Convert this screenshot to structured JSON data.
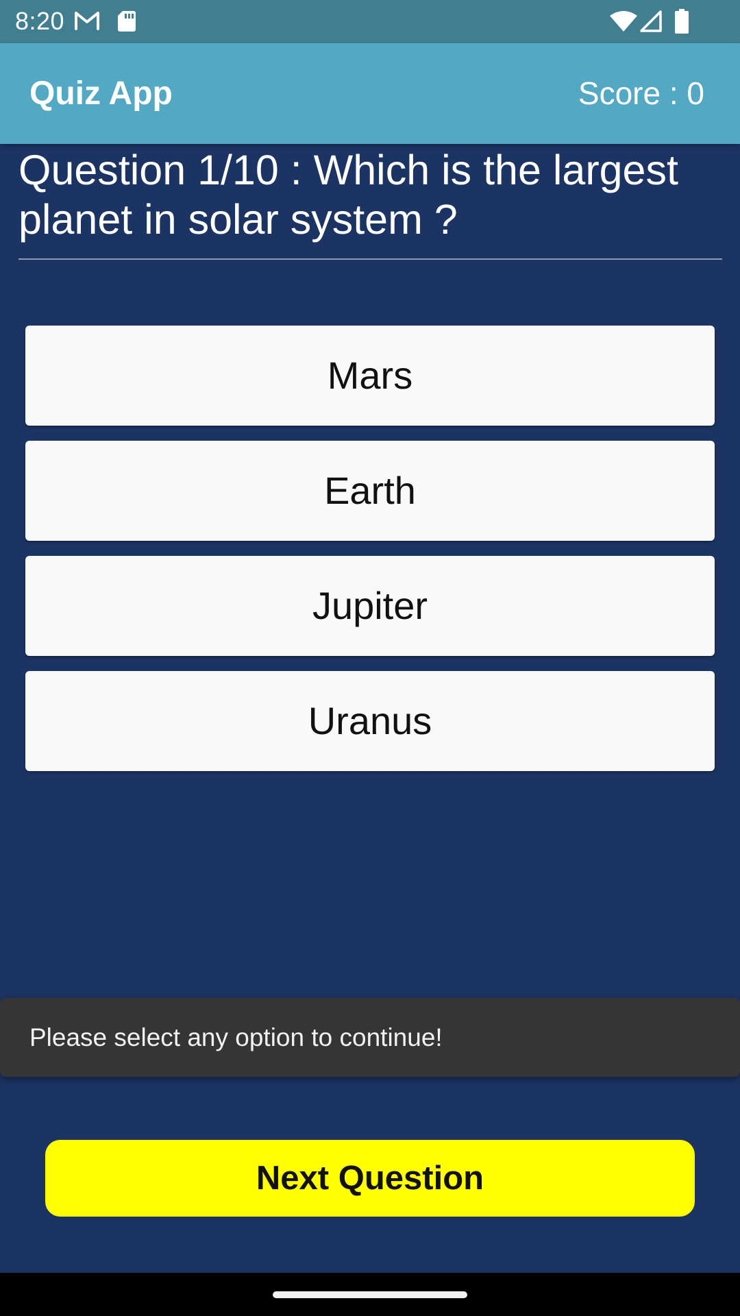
{
  "status_bar": {
    "time": "8:20",
    "background": "#407e90",
    "icons": [
      "gmail-icon",
      "sd-card-icon",
      "wifi-icon",
      "signal-icon",
      "battery-icon"
    ]
  },
  "app_bar": {
    "title": "Quiz App",
    "score_label": "Score : 0",
    "background": "#53a8c3"
  },
  "question": {
    "text": "Question 1/10 : Which is the largest planet in solar system ?"
  },
  "options": [
    {
      "label": "Mars"
    },
    {
      "label": "Earth"
    },
    {
      "label": "Jupiter"
    },
    {
      "label": "Uranus"
    }
  ],
  "toast": {
    "message": "Please select any option to continue!"
  },
  "next_button": {
    "label": "Next Question",
    "background": "#ffff00"
  },
  "colors": {
    "page_background": "#1c3463",
    "option_background": "#f9f9f9",
    "toast_background": "#353535"
  }
}
